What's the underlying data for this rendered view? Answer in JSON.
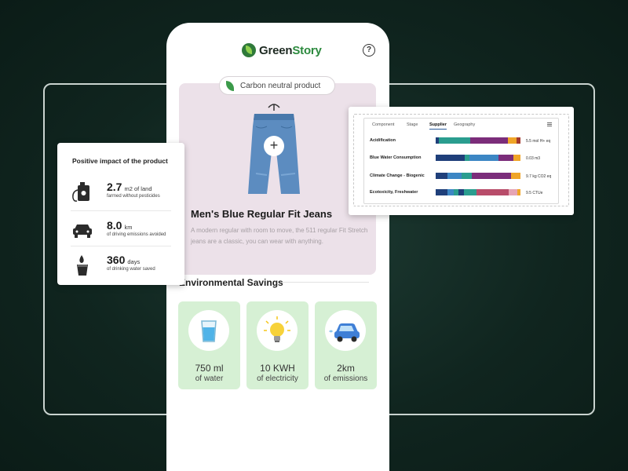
{
  "brand": {
    "name_part1": "Green",
    "name_part2": "Story"
  },
  "header": {
    "help_symbol": "?"
  },
  "product": {
    "badge": "Carbon neutral product",
    "title": "Men's Blue Regular Fit Jeans",
    "description": "A modern regular with room to move, the 511 regular Fit Stretch jeans are a classic, you can wear with anything.",
    "plus_symbol": "+"
  },
  "savings": {
    "title": "Environmental Savings",
    "items": [
      {
        "icon": "water-glass-icon",
        "value": "750 ml",
        "label": "of water"
      },
      {
        "icon": "lightbulb-icon",
        "value": "10 KWH",
        "label": "of  electricity"
      },
      {
        "icon": "car-icon",
        "value": "2km",
        "label": "of emissions"
      }
    ]
  },
  "impact": {
    "title": "Positive impact of the product",
    "rows": [
      {
        "icon": "pesticide-can-icon",
        "value": "2.7",
        "unit": "m2 of land",
        "sub": "farmed without pesticides"
      },
      {
        "icon": "car-front-icon",
        "value": "8.0",
        "unit": "km",
        "sub": "of driving emissions avoided"
      },
      {
        "icon": "water-drop-cup-icon",
        "value": "360",
        "unit": "days",
        "sub": "of drinking water saved"
      }
    ]
  },
  "chart": {
    "tabs": [
      "Component",
      "Stage",
      "Supplier",
      "Geography"
    ],
    "active_tab": "Supplier",
    "rows": [
      {
        "label": "Acidification",
        "value": "5.5 mol H+ eq",
        "segments": [
          [
            0.04,
            "#1f3f7a"
          ],
          [
            0.37,
            "#2a9d8f"
          ],
          [
            0.44,
            "#7b2d7a"
          ],
          [
            0.1,
            "#f0a528"
          ],
          [
            0.05,
            "#a33a2f"
          ]
        ]
      },
      {
        "label": "Blue Water Consumption",
        "value": "0.03 m3",
        "segments": [
          [
            0.34,
            "#1f3f7a"
          ],
          [
            0.06,
            "#2a9d8f"
          ],
          [
            0.34,
            "#3c86c4"
          ],
          [
            0.18,
            "#7b2d7a"
          ],
          [
            0.08,
            "#f0a528"
          ]
        ]
      },
      {
        "label": "Climate Change - Biogenic",
        "value": "9.7 kg CO2 eq",
        "segments": [
          [
            0.14,
            "#1f3f7a"
          ],
          [
            0.17,
            "#3c86c4"
          ],
          [
            0.12,
            "#2a9d8f"
          ],
          [
            0.46,
            "#7b2d7a"
          ],
          [
            0.11,
            "#f0a528"
          ]
        ]
      },
      {
        "label": "Ecotoxicity, Freshwater",
        "value": "9.5 CTUe",
        "segments": [
          [
            0.14,
            "#1f3f7a"
          ],
          [
            0.07,
            "#3c86c4"
          ],
          [
            0.06,
            "#2a9d8f"
          ],
          [
            0.06,
            "#1f3f7a"
          ],
          [
            0.15,
            "#2a9d8f"
          ],
          [
            0.38,
            "#b84c6a"
          ],
          [
            0.1,
            "#e6a4b4"
          ],
          [
            0.04,
            "#f0a528"
          ]
        ]
      }
    ]
  }
}
